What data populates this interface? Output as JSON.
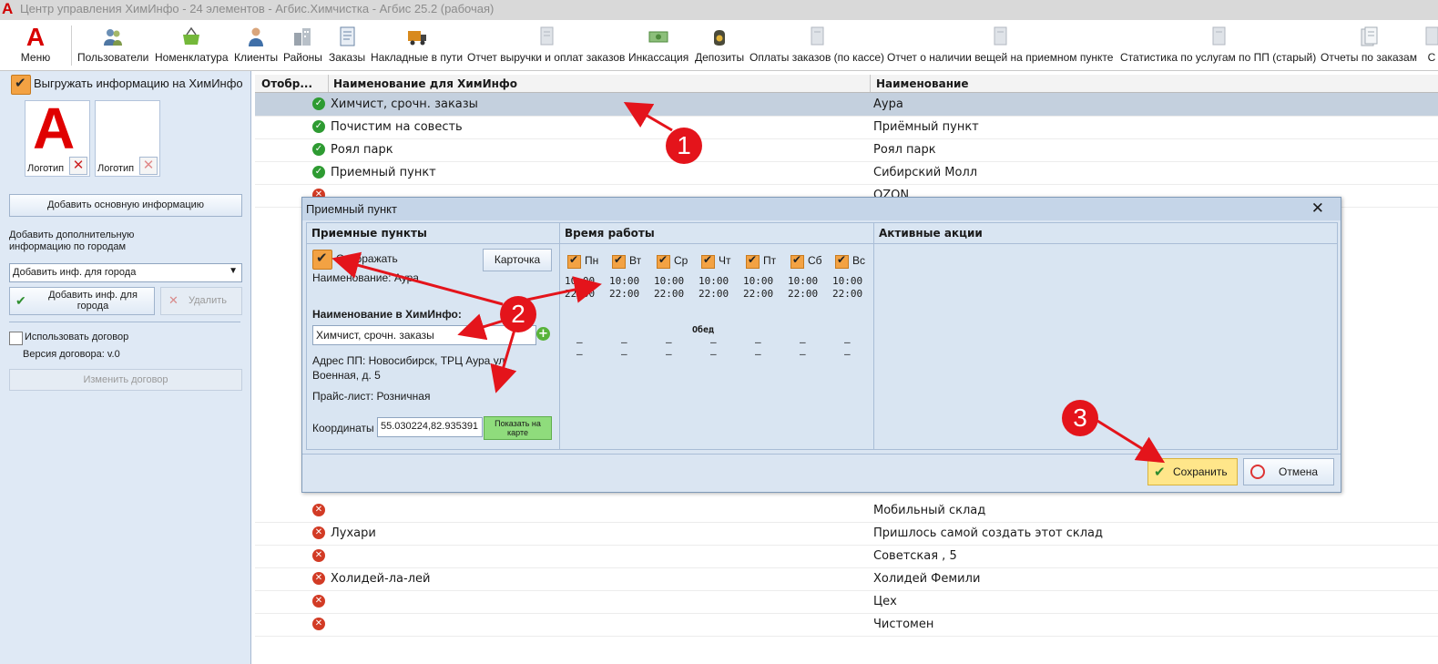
{
  "window": {
    "title": "Центр управления ХимИнфо - 24 элементов - Агбис.Химчистка - Агбис 25.2 (рабочая)",
    "app_logo": "A"
  },
  "ribbon": {
    "menu_label": "Меню",
    "menu_logo": "A",
    "items": [
      {
        "label": "Пользователи",
        "icon": "users-icon"
      },
      {
        "label": "Номенклатура",
        "icon": "basket-icon"
      },
      {
        "label": "Клиенты",
        "icon": "client-icon"
      },
      {
        "label": "Районы",
        "icon": "buildings-icon"
      },
      {
        "label": "Заказы",
        "icon": "document-icon"
      },
      {
        "label": "Накладные в пути",
        "icon": "truck-icon"
      },
      {
        "label": "Отчет выручки и оплат заказов",
        "icon": "report-icon"
      },
      {
        "label": "Инкассация",
        "icon": "money-icon"
      },
      {
        "label": "Депозиты",
        "icon": "coin-bag-icon"
      },
      {
        "label": "Оплаты заказов (по кассе)",
        "icon": "report-icon"
      },
      {
        "label": "Отчет о наличии вещей на приемном пункте",
        "icon": "report-icon"
      },
      {
        "label": "Статистика по услугам по ПП (старый)",
        "icon": "report-icon"
      },
      {
        "label": "Отчеты по заказам",
        "icon": "reports-icon"
      },
      {
        "label": "С",
        "icon": "report-icon"
      }
    ]
  },
  "left": {
    "export_label": "Выгружать информацию на ХимИнфо",
    "logo1_caption": "Логотип",
    "logo2_caption": "Логотип",
    "logo_letter": "A",
    "add_main_btn": "Добавить основную информацию",
    "add_city_text": "Добавить дополнительную информацию по городам",
    "city_select": "Добавить инф. для города",
    "add_city_btn": "Добавить инф. для города",
    "delete_btn": "Удалить",
    "use_contract_label": "Использовать договор",
    "contract_version": "Версия договора: v.0",
    "change_contract_btn": "Изменить договор"
  },
  "grid": {
    "headers": [
      "Отобр...",
      "Наименование для ХимИнфо",
      "Наименование"
    ],
    "rows_top": [
      {
        "status": "ok",
        "chem": "Химчист, срочн. заказы",
        "name": "Аура"
      },
      {
        "status": "ok",
        "chem": "Почистим на совесть",
        "name": "Приёмный пункт"
      },
      {
        "status": "ok",
        "chem": "Роял парк",
        "name": "Роял парк"
      },
      {
        "status": "ok",
        "chem": "Приемный пункт",
        "name": "Сибирский Молл"
      },
      {
        "status": "no",
        "chem": "",
        "name": "OZON"
      }
    ],
    "rows_bottom": [
      {
        "status": "no",
        "chem": "",
        "name": "Мобильный склад"
      },
      {
        "status": "no",
        "chem": "Лухари",
        "name": "Пришлось самой создать этот склад"
      },
      {
        "status": "no",
        "chem": "",
        "name": "Советская , 5"
      },
      {
        "status": "no",
        "chem": "Холидей-ла-лей",
        "name": "Холидей Фемили"
      },
      {
        "status": "no",
        "chem": "",
        "name": "Цех"
      },
      {
        "status": "no",
        "chem": "",
        "name": "Чистомен"
      }
    ]
  },
  "dialog": {
    "title": "Приемный пункт",
    "panel1_title": "Приемные пункты",
    "panel2_title": "Время работы",
    "panel3_title": "Активные акции",
    "show_label": "Отображать",
    "card_btn": "Карточка",
    "name_line": "Наименование: Аура",
    "chem_name_label": "Наименование в ХимИнфо:",
    "chem_name_value": "Химчист, срочн. заказы",
    "address_line1": "Адрес ПП: Новосибирск, ТРЦ Аура ул",
    "address_line2": "Военная, д. 5",
    "pricelist": "Прайс-лист: Розничная",
    "coords_label": "Координаты",
    "coords_value": "55.030224,82.935391",
    "map_btn": "Показать на карте",
    "days": [
      {
        "name": "Пн",
        "open": "10:00",
        "close": "22:00",
        "l1": "–",
        "l2": "–"
      },
      {
        "name": "Вт",
        "open": "10:00",
        "close": "22:00",
        "l1": "–",
        "l2": "–"
      },
      {
        "name": "Ср",
        "open": "10:00",
        "close": "22:00",
        "l1": "–",
        "l2": "–"
      },
      {
        "name": "Чт",
        "open": "10:00",
        "close": "22:00",
        "l1": "–",
        "l2": "–"
      },
      {
        "name": "Пт",
        "open": "10:00",
        "close": "22:00",
        "l1": "–",
        "l2": "–"
      },
      {
        "name": "Сб",
        "open": "10:00",
        "close": "22:00",
        "l1": "–",
        "l2": "–"
      },
      {
        "name": "Вс",
        "open": "10:00",
        "close": "22:00",
        "l1": "–",
        "l2": "–"
      }
    ],
    "lunch_label": "Обед",
    "save_btn": "Сохранить",
    "cancel_btn": "Отмена"
  },
  "annotations": [
    "1",
    "2",
    "3"
  ],
  "colors": {
    "annotation": "#e4141b",
    "accent_orange": "#f3a243",
    "selected_row": "#c4d0de",
    "panel_bg": "#dae5f2"
  }
}
